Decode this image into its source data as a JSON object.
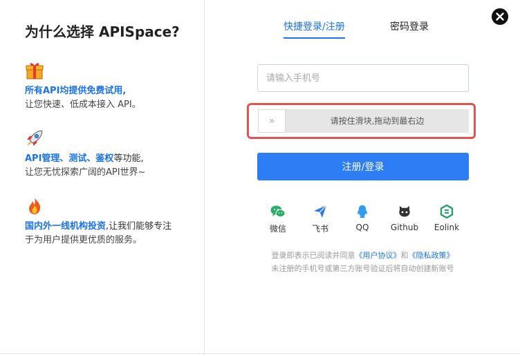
{
  "left": {
    "title": "为什么选择 APISpace?",
    "features": [
      {
        "icon": "gift-icon",
        "highlight": "所有API均提供免费试用,",
        "rest": "",
        "line2": "让您快速、低成本接入 API。"
      },
      {
        "icon": "rocket-icon",
        "highlight": "API管理、测试、鉴权",
        "rest": "等功能,",
        "line2": "让您无忧探索广阔的API世界~"
      },
      {
        "icon": "fire-icon",
        "highlight": "国内外一线机构投资",
        "rest": ",让我们能够专注",
        "line2": "于为用户提供更优质的服务。"
      }
    ]
  },
  "tabs": {
    "quick": "快捷登录/注册",
    "password": "密码登录"
  },
  "form": {
    "phone_placeholder": "请输入手机号",
    "phone_value": "",
    "slider_handle": "»",
    "slider_text": "请按住滑块,拖动到最右边",
    "submit_label": "注册/登录"
  },
  "social": [
    {
      "label": "微信",
      "icon": "wechat-icon",
      "color": "#2aae67"
    },
    {
      "label": "飞书",
      "icon": "feishu-icon",
      "color": "#2d7ef5"
    },
    {
      "label": "QQ",
      "icon": "qq-icon",
      "color": "#2d9cf2"
    },
    {
      "label": "Github",
      "icon": "github-icon",
      "color": "#333333"
    },
    {
      "label": "Eolink",
      "icon": "eolink-icon",
      "color": "#23a068"
    }
  ],
  "terms": {
    "prefix": "登录即表示已阅读并同意",
    "user_agreement": "《用户协议》",
    "and": "和",
    "privacy": "《隐私政策》",
    "line2": "未注册的手机号或第三方账号验证后将自动创建新账号"
  },
  "colors": {
    "accent": "#2d7ef5",
    "highlight_border": "#e05551"
  }
}
